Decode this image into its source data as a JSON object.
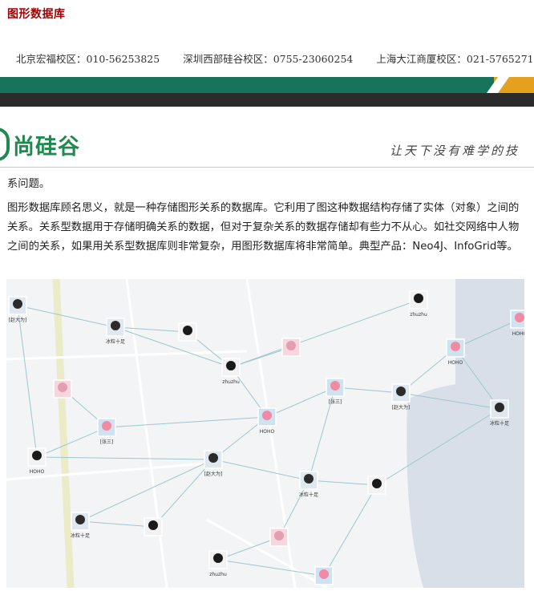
{
  "header": {
    "title": "图形数据库",
    "contacts": [
      "北京宏福校区：010-56253825",
      "深圳西部硅谷校区：0755-23060254",
      "上海大江商厦校区：021-57652717"
    ]
  },
  "brand": {
    "logo_text": "尚硅谷",
    "slogan": "让天下没有难学的技",
    "colors": {
      "green": "#17735a",
      "orange": "#e5a11e",
      "dark": "#2b2b2b",
      "title_red": "#a40000"
    }
  },
  "content": {
    "fragment": "系问题。",
    "paragraph": "图形数据库顾名思义，就是一种存储图形关系的数据库。它利用了图这种数据结构存储了实体（对象）之间的关系。关系型数据用于存储明确关系的数据，但对于复杂关系的数据存储却有些力不从心。如社交网络中人物之间的关系，如果用关系型数据库则非常复杂，用图形数据库将非常简单。典型产品：Neo4J、InfoGrid等。"
  },
  "graph": {
    "nodes": [
      {
        "label": "[赵大为]",
        "avatar": "boy-cap"
      },
      {
        "label": "冰粒十足",
        "avatar": "boy-cap"
      },
      {
        "label": "",
        "avatar": "girl"
      },
      {
        "label": "",
        "avatar": "pink"
      },
      {
        "label": "zhuzhu",
        "avatar": "girl"
      },
      {
        "label": "zhuzhu",
        "avatar": "girl"
      },
      {
        "label": "HOHO",
        "avatar": "pig"
      },
      {
        "label": "[张三]",
        "avatar": "pig"
      },
      {
        "label": "[赵大为]",
        "avatar": "boy-cap"
      },
      {
        "label": "冰粒十足",
        "avatar": "boy-cap"
      },
      {
        "label": "",
        "avatar": "pink"
      },
      {
        "label": "[张三]",
        "avatar": "pig"
      },
      {
        "label": "HOHO",
        "avatar": "pig"
      },
      {
        "label": "HOHO",
        "avatar": "girl"
      },
      {
        "label": "[赵大为]",
        "avatar": "boy-cap"
      },
      {
        "label": "冰粒十足",
        "avatar": "boy-cap"
      },
      {
        "label": "",
        "avatar": "girl"
      },
      {
        "label": "冰粒十足",
        "avatar": "boy-cap"
      },
      {
        "label": "",
        "avatar": "girl"
      },
      {
        "label": "",
        "avatar": "pink"
      },
      {
        "label": "zhuzhu",
        "avatar": "girl"
      },
      {
        "label": "",
        "avatar": "pig"
      },
      {
        "label": "HOHO",
        "avatar": "pig"
      }
    ]
  }
}
